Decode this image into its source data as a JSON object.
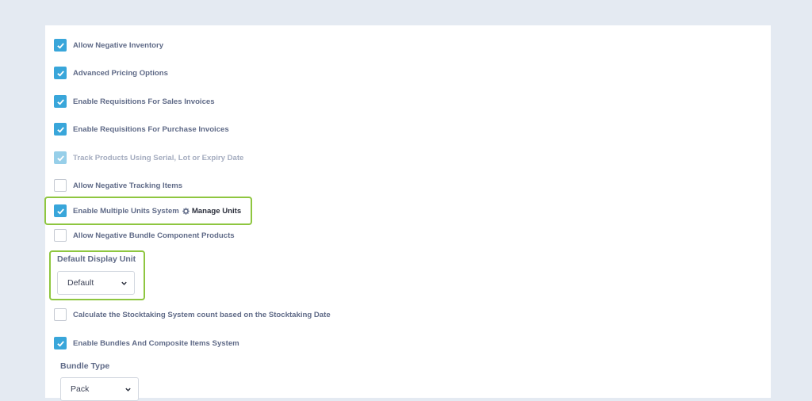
{
  "settings": {
    "allow_negative_inventory": {
      "label": "Allow Negative Inventory",
      "checked": true
    },
    "advanced_pricing": {
      "label": "Advanced Pricing Options",
      "checked": true
    },
    "requisitions_sales": {
      "label": "Enable Requisitions For Sales Invoices",
      "checked": true
    },
    "requisitions_purchase": {
      "label": "Enable Requisitions For Purchase Invoices",
      "checked": true
    },
    "track_products": {
      "label": "Track Products Using Serial, Lot or Expiry Date",
      "checked": true,
      "disabled": true
    },
    "negative_tracking": {
      "label": "Allow Negative Tracking Items",
      "checked": false
    },
    "multiple_units": {
      "label": "Enable Multiple Units System",
      "checked": true,
      "link_label": "Manage Units",
      "link_icon": "gear-icon"
    },
    "negative_bundle": {
      "label": "Allow Negative Bundle Component Products",
      "checked": false
    },
    "stocktaking_count": {
      "label": "Calculate the Stocktaking System count based on the Stocktaking Date",
      "checked": false
    },
    "bundles_system": {
      "label": "Enable Bundles And Composite Items System",
      "checked": true
    }
  },
  "default_display_unit": {
    "label": "Default Display Unit",
    "value": "Default"
  },
  "bundle_type": {
    "label": "Bundle Type",
    "value": "Pack"
  },
  "colors": {
    "checkbox_checked": "#39a6da",
    "highlight": "#8ec63f",
    "label_text": "#5f6a87",
    "background": "#e4eaf2"
  }
}
